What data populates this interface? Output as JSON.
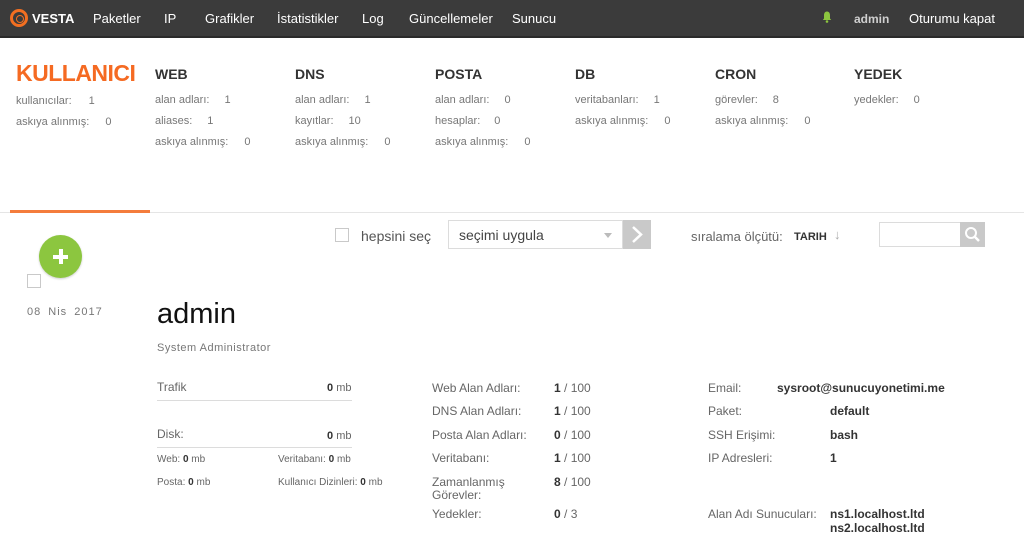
{
  "brand": {
    "name": "VESTA"
  },
  "nav": {
    "items": [
      {
        "label": "Paketler"
      },
      {
        "label": "IP"
      },
      {
        "label": "Grafikler"
      },
      {
        "label": "İstatistikler"
      },
      {
        "label": "Log"
      },
      {
        "label": "Güncellemeler"
      },
      {
        "label": "Sunucu"
      }
    ],
    "user": "admin",
    "logout": "Oturumu kapat"
  },
  "stats": {
    "user": {
      "title": "KULLANICI",
      "rows": [
        {
          "label": "kullanıcılar:",
          "value": "1"
        },
        {
          "label": "askıya alınmış:",
          "value": "0"
        }
      ]
    },
    "web": {
      "title": "WEB",
      "rows": [
        {
          "label": "alan adları:",
          "value": "1"
        },
        {
          "label": "aliases:",
          "value": "1"
        },
        {
          "label": "askıya alınmış:",
          "value": "0"
        }
      ]
    },
    "dns": {
      "title": "DNS",
      "rows": [
        {
          "label": "alan adları:",
          "value": "1"
        },
        {
          "label": "kayıtlar:",
          "value": "10"
        },
        {
          "label": "askıya alınmış:",
          "value": "0"
        }
      ]
    },
    "mail": {
      "title": "POSTA",
      "rows": [
        {
          "label": "alan adları:",
          "value": "0"
        },
        {
          "label": "hesaplar:",
          "value": "0"
        },
        {
          "label": "askıya alınmış:",
          "value": "0"
        }
      ]
    },
    "db": {
      "title": "DB",
      "rows": [
        {
          "label": "veritabanları:",
          "value": "1"
        },
        {
          "label": "askıya alınmış:",
          "value": "0"
        }
      ]
    },
    "cron": {
      "title": "CRON",
      "rows": [
        {
          "label": "görevler:",
          "value": "8"
        },
        {
          "label": "askıya alınmış:",
          "value": "0"
        }
      ]
    },
    "backup": {
      "title": "YEDEK",
      "rows": [
        {
          "label": "yedekler:",
          "value": "0"
        }
      ]
    }
  },
  "toolbar": {
    "select_all": "hepsini seç",
    "bulk_action": "seçimi uygula",
    "sort_label": "sıralama ölçütü:",
    "sort_value": "TARIH",
    "sort_arrow": "↓"
  },
  "account": {
    "date": "08 Nis 2017",
    "username": "admin",
    "role": "System Administrator",
    "traffic_label": "Trafik",
    "traffic_value": "0",
    "disk_label": "Disk:",
    "disk_value": "0",
    "unit_mb": "mb",
    "disk_web_label": "Web:",
    "disk_web_value": "0",
    "disk_db_label": "Veritabanı:",
    "disk_db_value": "0",
    "disk_mail_label": "Posta:",
    "disk_mail_value": "0",
    "disk_home_label": "Kullanıcı Dizinleri:",
    "disk_home_value": "0",
    "limits": [
      {
        "label": "Web Alan Adları:",
        "used": "1",
        "total": "/ 100"
      },
      {
        "label": "DNS Alan Adları:",
        "used": "1",
        "total": "/ 100"
      },
      {
        "label": "Posta Alan Adları:",
        "used": "0",
        "total": "/ 100"
      },
      {
        "label": "Veritabanı:",
        "used": "1",
        "total": "/ 100"
      },
      {
        "label": "Zamanlanmış",
        "label2": "Görevler:",
        "used": "8",
        "total": "/ 100"
      },
      {
        "label": "Yedekler:",
        "used": "0",
        "total": "/ 3"
      }
    ],
    "info": {
      "email_label": "Email:",
      "email_value": "sysroot@sunucuyonetimi.me",
      "package_label": "Paket:",
      "package_value": "default",
      "ssh_label": "SSH Erişimi:",
      "ssh_value": "bash",
      "ip_label": "IP Adresleri:",
      "ip_value": "1",
      "ns_label": "Alan Adı Sunucuları:",
      "ns1": "ns1.localhost.ltd",
      "ns2": "ns2.localhost.ltd"
    }
  }
}
